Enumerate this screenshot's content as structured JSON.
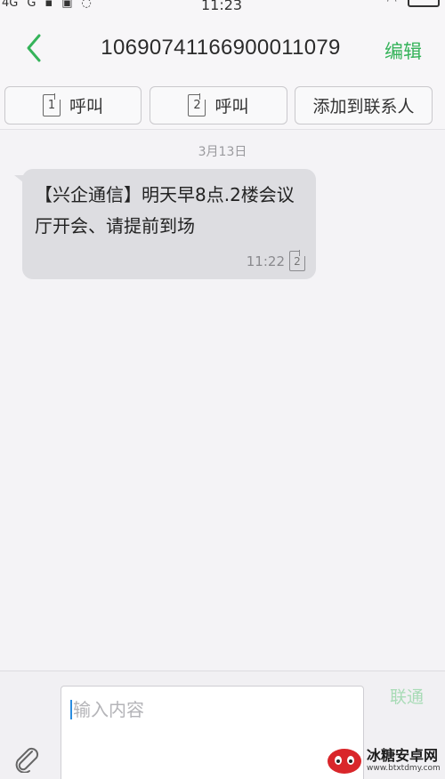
{
  "statusbar": {
    "signal_1": "4G",
    "signal_2": "G",
    "time": "11:23"
  },
  "header": {
    "title": "10690741166900011079",
    "edit_label": "编辑"
  },
  "actions": {
    "call_sim1": {
      "sim": "1",
      "label": "呼叫"
    },
    "call_sim2": {
      "sim": "2",
      "label": "呼叫"
    },
    "add_contact_label": "添加到联系人"
  },
  "conversation": {
    "date_label": "3月13日",
    "messages": [
      {
        "text": "【兴企通信】明天早8点.2楼会议厅开会、请提前到场",
        "time": "11:22",
        "sim": "2"
      }
    ]
  },
  "composer": {
    "placeholder": "输入内容",
    "send_label": "联通"
  },
  "watermark": {
    "name": "冰糖安卓网",
    "url": "www.btxtdmy.com"
  },
  "colors": {
    "accent": "#35b35a",
    "bubble_bg": "#dddde1",
    "background": "#f4f3f6"
  }
}
